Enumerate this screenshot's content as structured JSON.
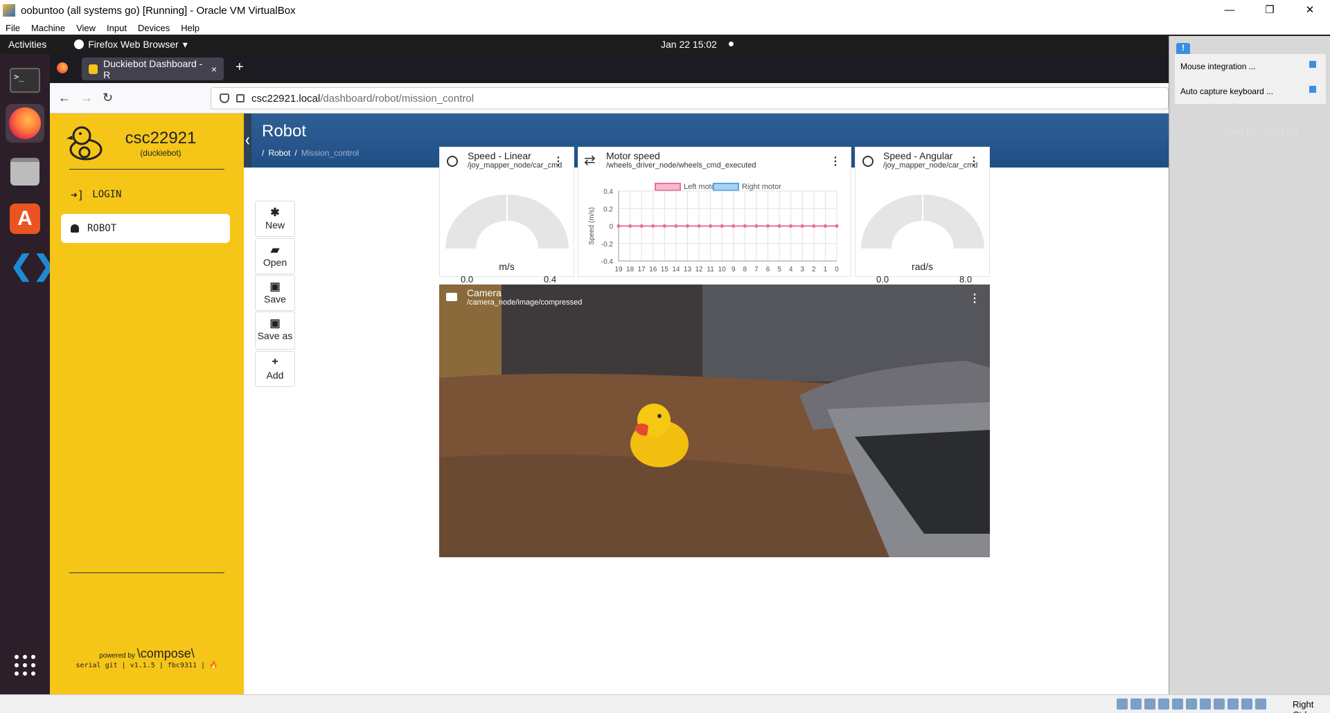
{
  "vbox": {
    "title": "oobuntoo (all systems go) [Running] - Oracle VM VirtualBox",
    "menu": [
      "File",
      "Machine",
      "View",
      "Input",
      "Devices",
      "Help"
    ],
    "minimize": "—",
    "maximize": "❐",
    "close": "✕",
    "notifications": [
      "Mouse integration ...",
      "Auto capture keyboard ..."
    ],
    "status_key": "Right Ctrl"
  },
  "gnome": {
    "activities": "Activities",
    "app": "Firefox Web Browser",
    "app_caret": "▾",
    "clock": "Jan 22  15:02"
  },
  "firefox": {
    "tab_title": "Duckiebot Dashboard - R",
    "tab_close": "×",
    "new_tab": "+",
    "back": "←",
    "forward": "→",
    "reload": "↻",
    "url_host": "csc22921.local",
    "url_path": "/dashboard/robot/mission_control"
  },
  "sidebar": {
    "robot_name": "csc22921",
    "robot_type": "(duckiebot)",
    "login": "LOGIN",
    "robot": "ROBOT",
    "powered_by": "powered by",
    "compose": "\\compose\\",
    "version": "serial git | v1.1.5 | fbc9311 | 🔥"
  },
  "header": {
    "title": "Robot",
    "breadcrumb_sep": "/",
    "crumb1": "Robot",
    "crumb2": "Mission_control",
    "signin": "Sign in / Sign up"
  },
  "toolbar": {
    "new": "New",
    "open": "Open",
    "save": "Save",
    "save_as": "Save as",
    "add": "Add"
  },
  "cards": {
    "speed_linear": {
      "title": "Speed - Linear",
      "topic": "/joy_mapper_node/car_cmd",
      "unit": "m/s",
      "min": "0.0",
      "max": "0.4",
      "value": 0
    },
    "motor_speed": {
      "title": "Motor speed",
      "topic": "/wheels_driver_node/wheels_cmd_executed"
    },
    "speed_angular": {
      "title": "Speed - Angular",
      "topic": "/joy_mapper_node/car_cmd",
      "unit": "rad/s",
      "min": "0.0",
      "max": "8.0",
      "value": 0
    },
    "camera": {
      "title": "Camera",
      "topic": "/camera_node/image/compressed"
    }
  },
  "chart_data": {
    "type": "line",
    "title": "",
    "xlabel": "",
    "ylabel": "Speed (m/s)",
    "x": [
      19,
      18,
      17,
      16,
      15,
      14,
      13,
      12,
      11,
      10,
      9,
      8,
      7,
      6,
      5,
      4,
      3,
      2,
      1,
      0
    ],
    "y_ticks": [
      "0.4",
      "0.2",
      "0",
      "-0.2",
      "-0.4"
    ],
    "ylim": [
      -0.4,
      0.4
    ],
    "series": [
      {
        "name": "Left motor",
        "values": [
          0,
          0,
          0,
          0,
          0,
          0,
          0,
          0,
          0,
          0,
          0,
          0,
          0,
          0,
          0,
          0,
          0,
          0,
          0,
          0
        ],
        "color": "#ea6f95"
      },
      {
        "name": "Right motor",
        "values": [
          0,
          0,
          0,
          0,
          0,
          0,
          0,
          0,
          0,
          0,
          0,
          0,
          0,
          0,
          0,
          0,
          0,
          0,
          0,
          0
        ],
        "color": "#4ea6e8"
      }
    ],
    "legend": "top",
    "grid": true
  }
}
